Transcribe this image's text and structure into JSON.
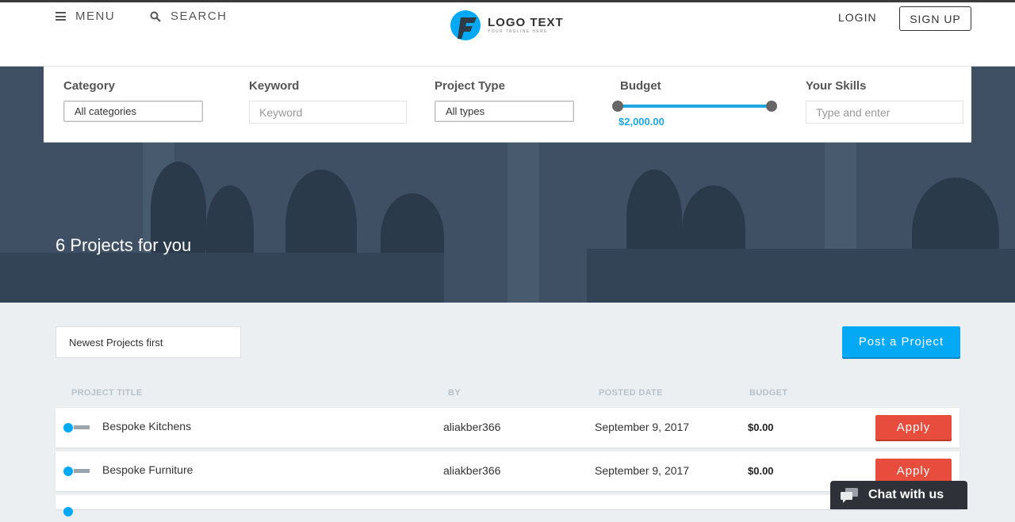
{
  "header": {
    "menu_label": "MENU",
    "search_label": "SEARCH",
    "logo_title": "LOGO TEXT",
    "logo_tagline": "YOUR TAGLINE HERE",
    "login_label": "LOGIN",
    "signup_label": "SIGN UP"
  },
  "filters": {
    "category": {
      "label": "Category",
      "value": "All categories"
    },
    "keyword": {
      "label": "Keyword",
      "placeholder": "Keyword"
    },
    "project_type": {
      "label": "Project Type",
      "value": "All types"
    },
    "budget": {
      "label": "Budget",
      "value": "$2,000.00",
      "level": 1.0
    },
    "skills": {
      "label": "Your Skills",
      "placeholder": "Type and enter"
    }
  },
  "hero": {
    "title": "6 Projects for you"
  },
  "list": {
    "sort_value": "Newest Projects first",
    "post_button": "Post a Project",
    "columns": [
      "PROJECT TITLE",
      "BY",
      "POSTED DATE",
      "BUDGET"
    ],
    "rows": [
      {
        "title": "Bespoke Kitchens",
        "by": "aliakber366",
        "date": "September 9, 2017",
        "budget": "$0.00",
        "action": "Apply"
      },
      {
        "title": "Bespoke Furniture",
        "by": "aliakber366",
        "date": "September 9, 2017",
        "budget": "$0.00",
        "action": "Apply"
      }
    ]
  },
  "chat": {
    "label": "Chat with us"
  },
  "colors": {
    "accent": "#03a9f4",
    "apply": "#e74c3c",
    "hero": "#3f5064",
    "chat": "#2e3238"
  }
}
